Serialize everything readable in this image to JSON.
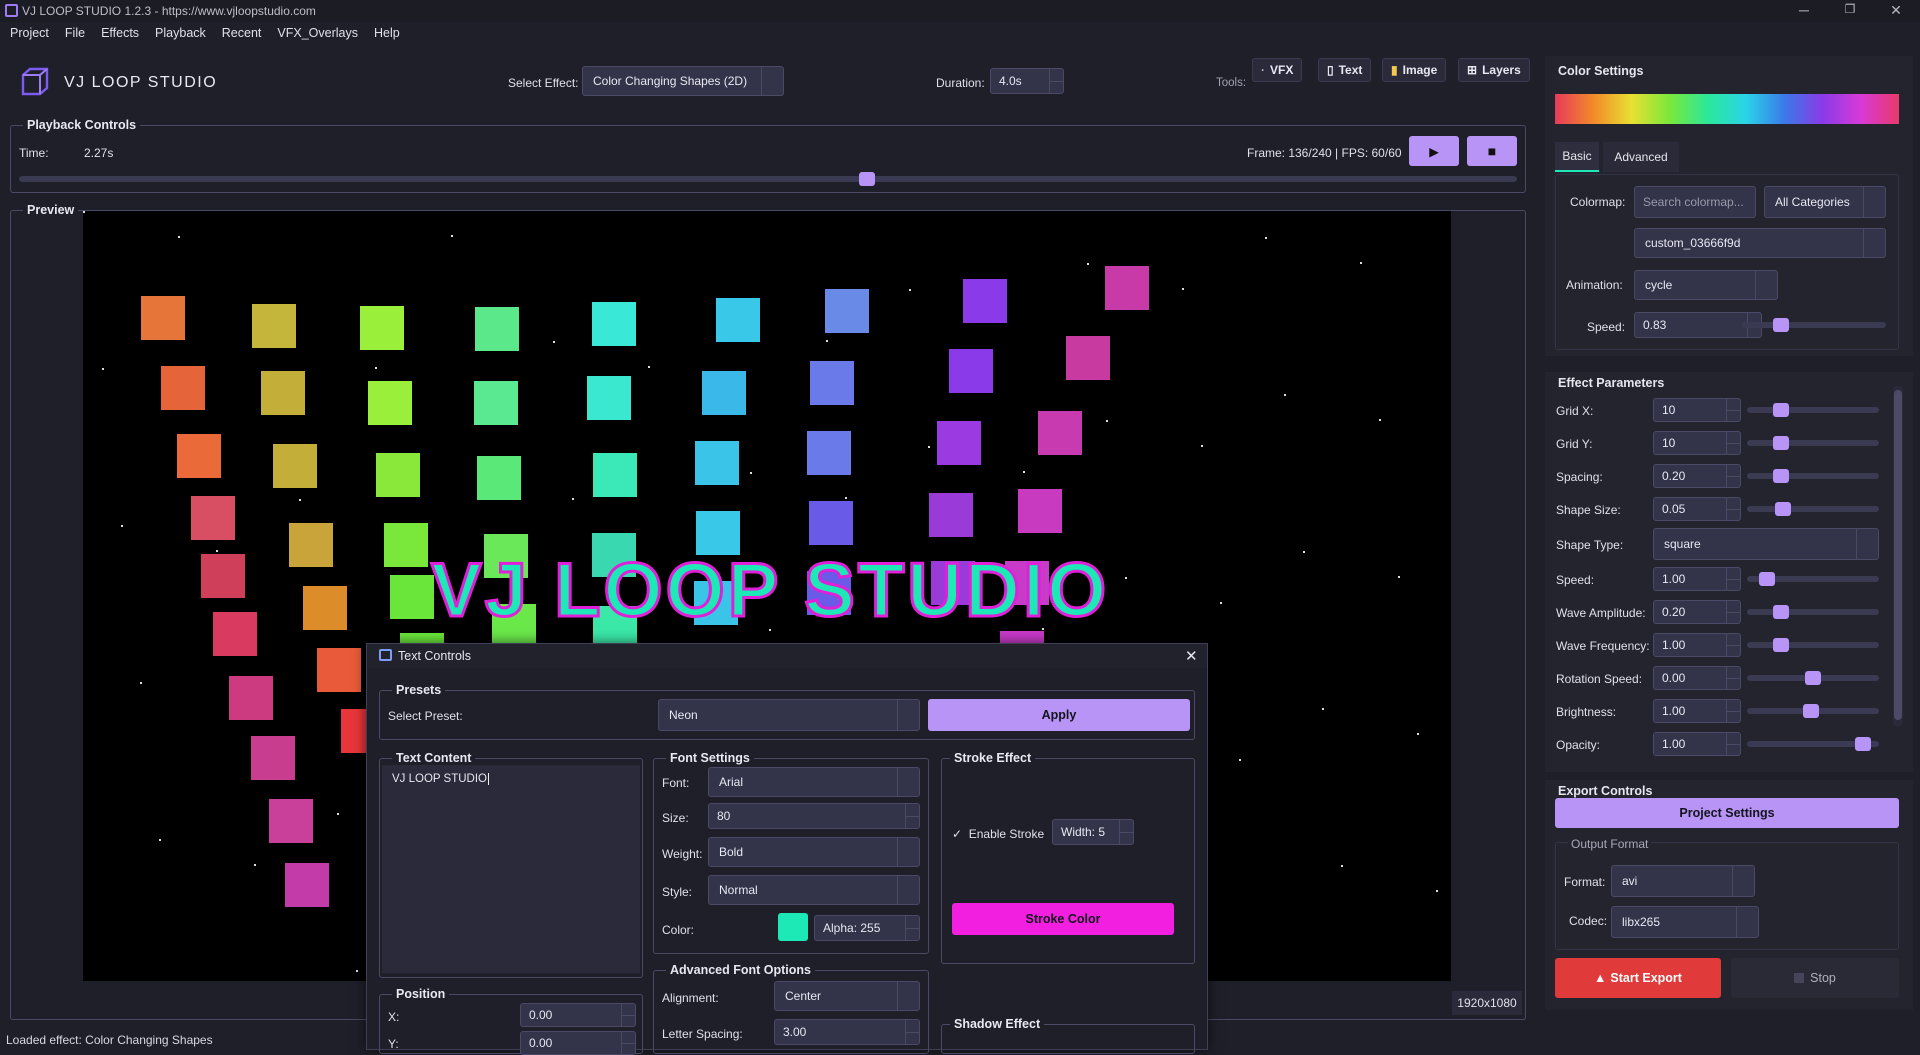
{
  "window": {
    "title": "VJ LOOP STUDIO 1.2.3 - https://www.vjloopstudio.com"
  },
  "menu": [
    "Project",
    "File",
    "Effects",
    "Playback",
    "Recent",
    "VFX_Overlays",
    "Help"
  ],
  "header": {
    "logo_text": "VJ LOOP STUDIO",
    "select_effect_label": "Select Effect:",
    "effect_value": "Color Changing Shapes (2D)",
    "duration_label": "Duration:",
    "duration_value": "4.0s",
    "tools_label": "Tools:",
    "tools": [
      {
        "label": "VFX",
        "icon": "sparkle-icon"
      },
      {
        "label": "Text",
        "icon": "document-icon"
      },
      {
        "label": "Image",
        "icon": "image-icon"
      },
      {
        "label": "Layers",
        "icon": "grid-icon"
      }
    ]
  },
  "playback": {
    "title": "Playback Controls",
    "time_label": "Time:",
    "time_value": "2.27s",
    "frame_text": "Frame: 136/240 | FPS: 60/60",
    "progress": 0.567
  },
  "preview": {
    "title": "Preview",
    "overlay_text": "VJ LOOP STUDIO",
    "resolution": "1920x1080"
  },
  "text_controls": {
    "title": "Text Controls",
    "presets": {
      "title": "Presets",
      "label": "Select Preset:",
      "value": "Neon",
      "apply": "Apply"
    },
    "content": {
      "title": "Text Content",
      "value": "VJ LOOP STUDIO"
    },
    "font": {
      "title": "Font Settings",
      "font_label": "Font:",
      "font": "Arial",
      "size_label": "Size:",
      "size": "80",
      "weight_label": "Weight:",
      "weight": "Bold",
      "style_label": "Style:",
      "style": "Normal",
      "color_label": "Color:",
      "alpha": "Alpha: 255",
      "color": "#1de9b6"
    },
    "stroke": {
      "title": "Stroke Effect",
      "enable": "Enable Stroke",
      "width": "Width: 5",
      "color_btn": "Stroke Color",
      "color": "#f21fe0"
    },
    "position": {
      "title": "Position",
      "x_label": "X:",
      "x": "0.00",
      "y_label": "Y:",
      "y": "0.00"
    },
    "advanced": {
      "title": "Advanced Font Options",
      "align_label": "Alignment:",
      "align": "Center",
      "spacing_label": "Letter Spacing:",
      "spacing": "3.00"
    },
    "shadow": {
      "title": "Shadow Effect"
    }
  },
  "color_settings": {
    "title": "Color Settings",
    "tabs": [
      "Basic",
      "Advanced"
    ],
    "colormap_label": "Colormap:",
    "search_placeholder": "Search colormap...",
    "category": "All Categories",
    "colormap": "custom_03666f9d",
    "animation_label": "Animation:",
    "animation": "cycle",
    "speed_label": "Speed:",
    "speed": "0.83",
    "speed_level": 0.24
  },
  "effect_params": {
    "title": "Effect Parameters",
    "items": [
      {
        "label": "Grid X:",
        "value": "10",
        "level": 0.22
      },
      {
        "label": "Grid Y:",
        "value": "10",
        "level": 0.22
      },
      {
        "label": "Spacing:",
        "value": "0.20",
        "level": 0.22
      },
      {
        "label": "Shape Size:",
        "value": "0.05",
        "level": 0.24
      },
      {
        "label": "Shape Type:",
        "value": "square"
      },
      {
        "label": "Speed:",
        "value": "1.00",
        "level": 0.1
      },
      {
        "label": "Wave Amplitude:",
        "value": "0.20",
        "level": 0.22
      },
      {
        "label": "Wave Frequency:",
        "value": "1.00",
        "level": 0.22
      },
      {
        "label": "Rotation Speed:",
        "value": "0.00",
        "level": 0.5
      },
      {
        "label": "Brightness:",
        "value": "1.00",
        "level": 0.48
      },
      {
        "label": "Opacity:",
        "value": "1.00",
        "level": 0.93
      }
    ]
  },
  "export": {
    "title": "Export Controls",
    "project_settings": "Project Settings",
    "output_format": "Output Format",
    "format_label": "Format:",
    "format": "avi",
    "codec_label": "Codec:",
    "codec": "libx265",
    "start": "Start Export",
    "stop": "Stop"
  },
  "status": "Loaded effect: Color Changing Shapes",
  "colors": {
    "accent": "#b794f6",
    "panel_bg": "#1f1f29",
    "start_export": "#e03a3a"
  }
}
